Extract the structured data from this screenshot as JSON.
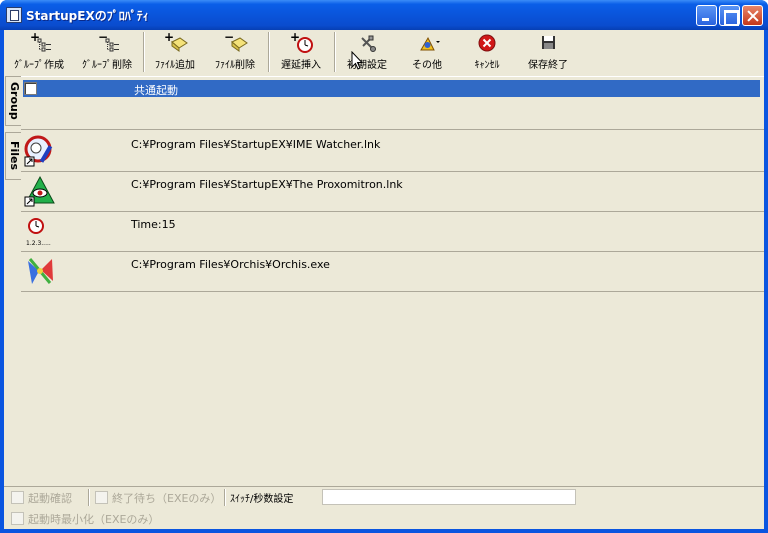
{
  "window": {
    "title": "StartupEXのﾌﾟﾛﾊﾟﾃｨ"
  },
  "toolbar": {
    "group_create": "ｸﾞﾙｰﾌﾟ作成",
    "group_delete": "ｸﾞﾙｰﾌﾟ削除",
    "file_add": "ﾌｧｲﾙ追加",
    "file_delete": "ﾌｧｲﾙ削除",
    "delay_insert": "遅延挿入",
    "initial_settings": "初期設定",
    "other": "その他",
    "cancel": "ｷｬﾝｾﾙ",
    "save_exit": "保存終了"
  },
  "tabs": {
    "group": "Group",
    "files": "Files"
  },
  "groups": [
    {
      "name": "共通起動",
      "checked": false
    }
  ],
  "files": [
    {
      "path": "C:¥Program Files¥StartupEX¥IME Watcher.lnk",
      "icon": "ime-watcher-icon"
    },
    {
      "path": "C:¥Program Files¥StartupEX¥The Proxomitron.lnk",
      "icon": "proxomitron-icon"
    },
    {
      "path": "Time:15",
      "icon": "clock-delay-icon",
      "icon_caption": "1.2.3....."
    },
    {
      "path": "C:¥Program Files¥Orchis¥Orchis.exe",
      "icon": "orchis-icon"
    }
  ],
  "status": {
    "launch_confirm": "起動確認",
    "wait_finish": "終了待ち（EXEのみ）",
    "switch_seconds_label": "ｽｲｯﾁ/秒数設定",
    "switch_seconds_value": "",
    "minimize_on_launch": "起動時最小化（EXEのみ）"
  },
  "colors": {
    "selection": "#316ac5",
    "face": "#ece9d8",
    "titlebar": "#0a53d9"
  }
}
